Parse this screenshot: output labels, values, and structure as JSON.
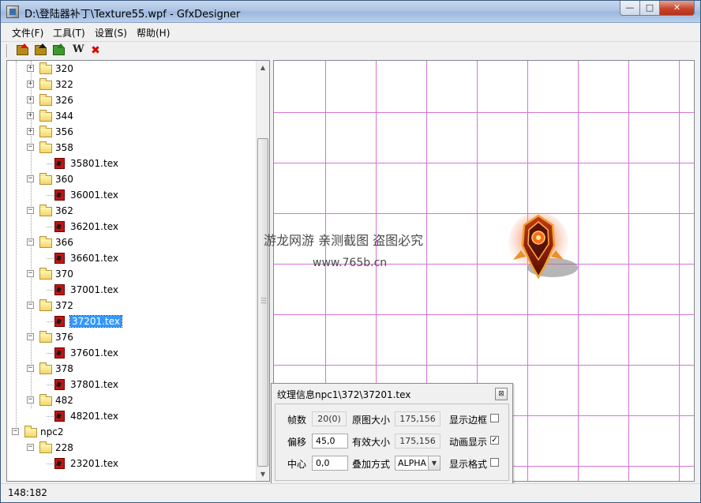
{
  "window": {
    "title": "D:\\登陆器补丁\\Texture55.wpf - GfxDesigner",
    "controls": {
      "minimize": "—",
      "maximize": "□",
      "close": "✕"
    }
  },
  "menu": [
    "文件(F)",
    "工具(T)",
    "设置(S)",
    "帮助(H)"
  ],
  "toolbar": {
    "buttons": [
      "open-folder-icon",
      "save-folder-icon",
      "export-folder-icon",
      "w-icon",
      "delete-icon"
    ],
    "w_label": "W",
    "x_label": "✖"
  },
  "tree": {
    "nodes": [
      {
        "label": "320",
        "type": "folder",
        "expanded": false
      },
      {
        "label": "322",
        "type": "folder",
        "expanded": false
      },
      {
        "label": "326",
        "type": "folder",
        "expanded": false
      },
      {
        "label": "344",
        "type": "folder",
        "expanded": false
      },
      {
        "label": "356",
        "type": "folder",
        "expanded": false
      },
      {
        "label": "358",
        "type": "folder",
        "expanded": true
      },
      {
        "label": "35801.tex",
        "type": "file"
      },
      {
        "label": "360",
        "type": "folder",
        "expanded": true
      },
      {
        "label": "36001.tex",
        "type": "file"
      },
      {
        "label": "362",
        "type": "folder",
        "expanded": true
      },
      {
        "label": "36201.tex",
        "type": "file"
      },
      {
        "label": "366",
        "type": "folder",
        "expanded": true
      },
      {
        "label": "36601.tex",
        "type": "file"
      },
      {
        "label": "370",
        "type": "folder",
        "expanded": true
      },
      {
        "label": "37001.tex",
        "type": "file"
      },
      {
        "label": "372",
        "type": "folder",
        "expanded": true
      },
      {
        "label": "37201.tex",
        "type": "file",
        "selected": true
      },
      {
        "label": "376",
        "type": "folder",
        "expanded": true
      },
      {
        "label": "37601.tex",
        "type": "file"
      },
      {
        "label": "378",
        "type": "folder",
        "expanded": true
      },
      {
        "label": "37801.tex",
        "type": "file"
      },
      {
        "label": "482",
        "type": "folder",
        "expanded": true
      },
      {
        "label": "48201.tex",
        "type": "file"
      },
      {
        "label": "npc2",
        "type": "root-folder",
        "expanded": true
      },
      {
        "label": "228",
        "type": "folder",
        "expanded": true
      },
      {
        "label": "23201.tex",
        "type": "file"
      }
    ]
  },
  "watermark": {
    "line1": "游龙网游 亲测截图 盗图必究",
    "line2": "www.765b.cn"
  },
  "info_dialog": {
    "title": "纹理信息npc1\\372\\37201.tex",
    "close": "⊠",
    "frame_label": "帧数",
    "frame_value": "20(0)",
    "orig_size_label": "原图大小",
    "orig_size_value": "175,156",
    "show_border_label": "显示边框",
    "show_border_checked": false,
    "offset_label": "偏移",
    "offset_value": "45,0",
    "valid_size_label": "有效大小",
    "valid_size_value": "175,156",
    "anim_label": "动画显示",
    "anim_checked": true,
    "center_label": "中心",
    "center_value": "0,0",
    "blend_label": "叠加方式",
    "blend_value": "ALPHA",
    "show_grid_label": "显示格式",
    "show_grid_checked": false
  },
  "status": {
    "coords": "148:182"
  }
}
